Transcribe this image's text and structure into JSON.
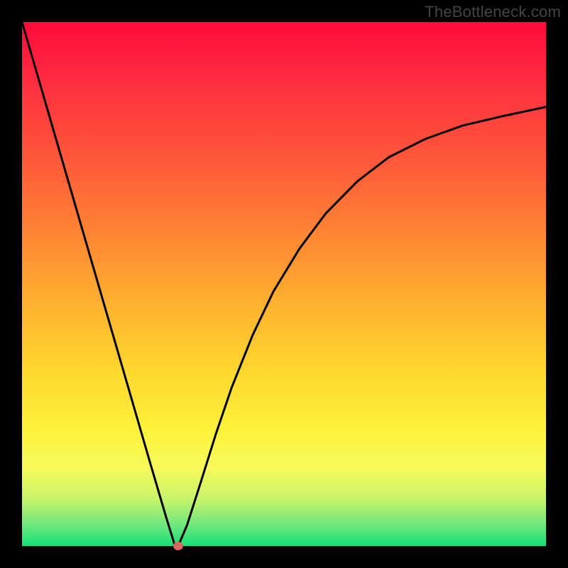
{
  "watermark": "TheBottleneck.com",
  "chart_data": {
    "type": "line",
    "title": "",
    "xlabel": "",
    "ylabel": "",
    "xlim": [
      0,
      1
    ],
    "ylim": [
      0,
      1
    ],
    "series": [
      {
        "name": "curve",
        "x": [
          0.0,
          0.05,
          0.1,
          0.15,
          0.2,
          0.245,
          0.275,
          0.292,
          0.292,
          0.298,
          0.315,
          0.34,
          0.37,
          0.4,
          0.44,
          0.48,
          0.53,
          0.58,
          0.64,
          0.7,
          0.77,
          0.84,
          0.92,
          1.0
        ],
        "y": [
          1.0,
          0.828,
          0.656,
          0.484,
          0.312,
          0.157,
          0.055,
          0.0,
          0.0,
          0.0,
          0.04,
          0.118,
          0.214,
          0.302,
          0.402,
          0.486,
          0.568,
          0.635,
          0.696,
          0.742,
          0.777,
          0.802,
          0.821,
          0.838
        ]
      }
    ],
    "marker": {
      "x": 0.298,
      "y": 0.0,
      "color": "#d9695f"
    },
    "gradient_stops": [
      {
        "pos": 0.0,
        "color": "#ff0a3c"
      },
      {
        "pos": 0.12,
        "color": "#ff2f40"
      },
      {
        "pos": 0.27,
        "color": "#ff5a3a"
      },
      {
        "pos": 0.42,
        "color": "#ff8a33"
      },
      {
        "pos": 0.55,
        "color": "#ffb52f"
      },
      {
        "pos": 0.67,
        "color": "#ffd82e"
      },
      {
        "pos": 0.78,
        "color": "#fdf23b"
      },
      {
        "pos": 0.85,
        "color": "#f7fa5a"
      },
      {
        "pos": 0.91,
        "color": "#c9f46a"
      },
      {
        "pos": 0.96,
        "color": "#6ee87e"
      },
      {
        "pos": 1.0,
        "color": "#17df78"
      }
    ]
  }
}
